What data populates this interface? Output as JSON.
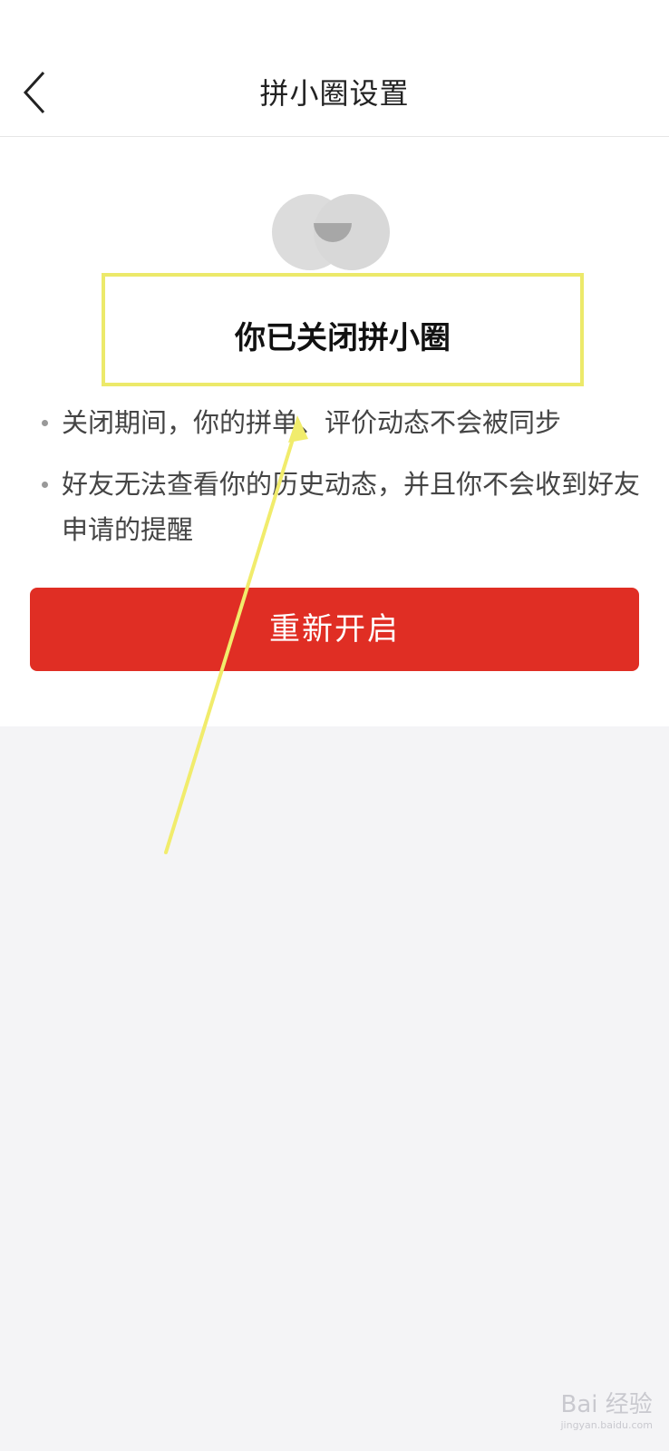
{
  "header": {
    "title": "拼小圈设置",
    "back_icon": "chevron-left-icon"
  },
  "status": {
    "title": "你已关闭拼小圈",
    "bullets": [
      "关闭期间，你的拼单、评价动态不会被同步",
      "好友无法查看你的历史动态，并且你不会收到好友申请的提醒"
    ]
  },
  "actions": {
    "reopen_label": "重新开启"
  },
  "watermark": {
    "brand": "Bai 经验",
    "domain": "jingyan.baidu.com"
  },
  "colors": {
    "primary_red": "#e02e24",
    "highlight_yellow": "#ece96a"
  }
}
